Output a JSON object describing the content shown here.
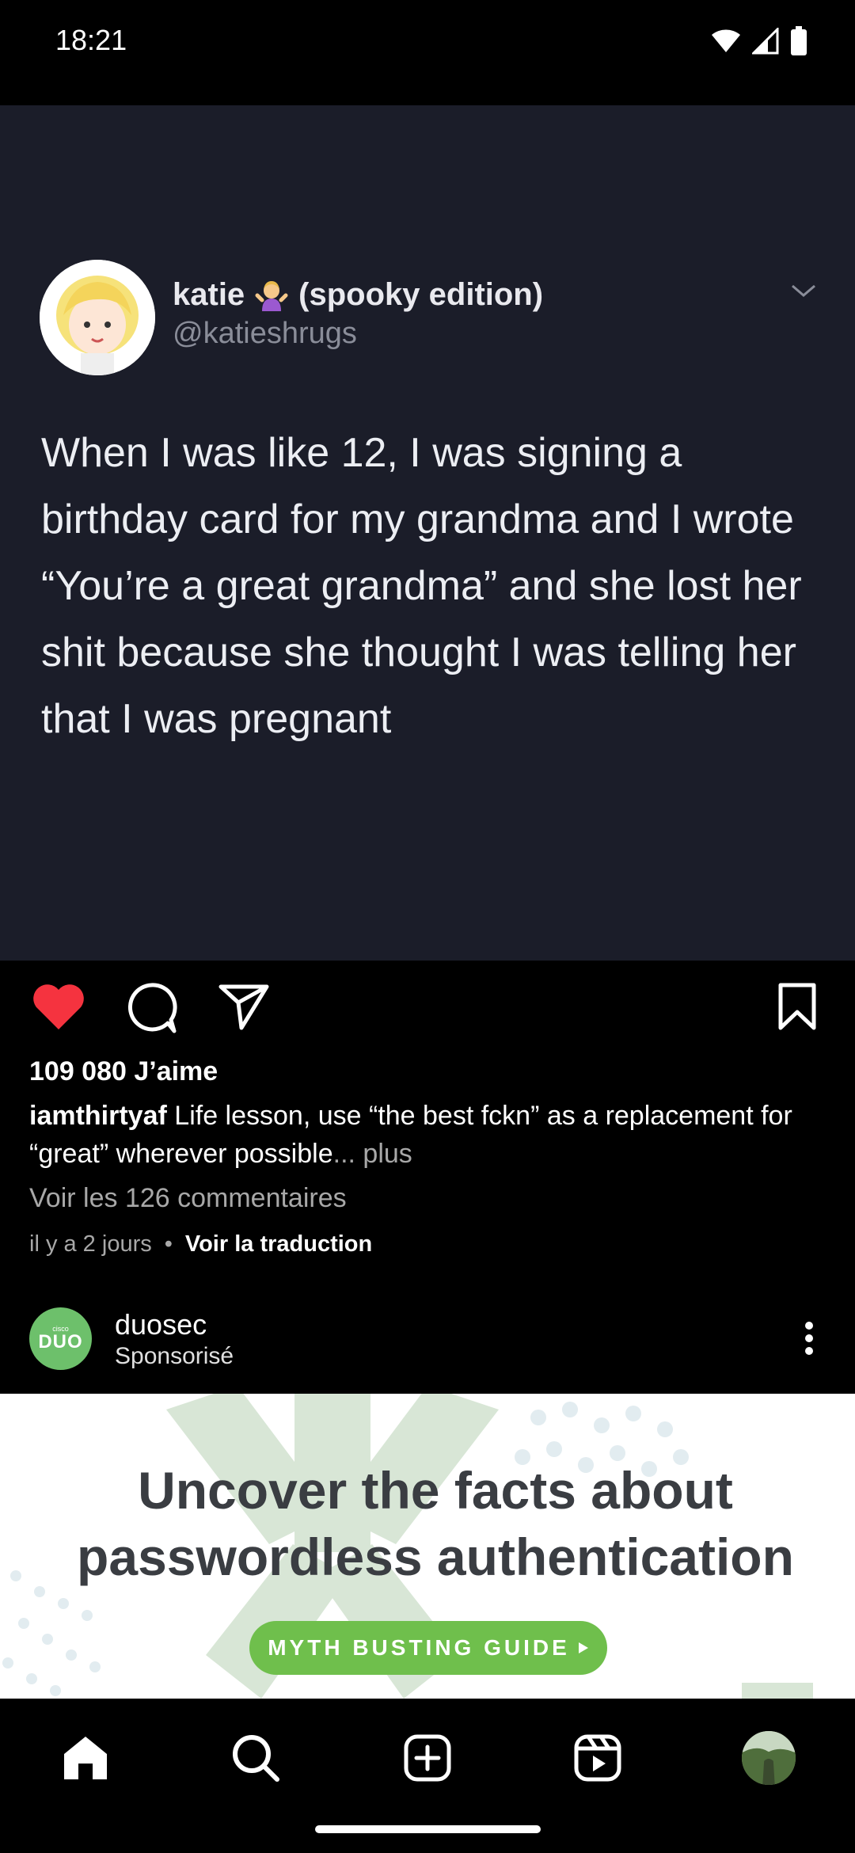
{
  "status_bar": {
    "time": "18:21"
  },
  "tweet": {
    "display_name": "katie",
    "name_suffix": "(spooky edition)",
    "handle": "@katieshrugs",
    "text": "When I was like 12, I was signing a birthday card for my grandma and I wrote “You’re a great grandma” and she lost her shit because she thought I was telling her that I was pregnant"
  },
  "post": {
    "likes": "109 080 J’aime",
    "username": "iamthirtyaf",
    "caption": "Life lesson, use “the best fckn” as a replacement for “great” wherever possible",
    "more": "... plus",
    "view_comments": "Voir les 126 commentaires",
    "time_ago": "il y a 2 jours",
    "separator": "•",
    "translate": "Voir la traduction",
    "liked": true
  },
  "sponsored": {
    "account": "duosec",
    "label": "Sponsorisé",
    "avatar_tag": "cisco",
    "avatar_text": "DUO"
  },
  "ad": {
    "title": "Uncover the facts about passwordless authentication",
    "cta": "MYTH BUSTING GUIDE",
    "cta_color": "#6fbf4c"
  },
  "nav": {
    "items": [
      "home-icon",
      "search-icon",
      "new-post-icon",
      "reels-icon",
      "profile-avatar"
    ]
  },
  "colors": {
    "like_red": "#f5333f",
    "tweet_bg": "#1b1d29"
  }
}
